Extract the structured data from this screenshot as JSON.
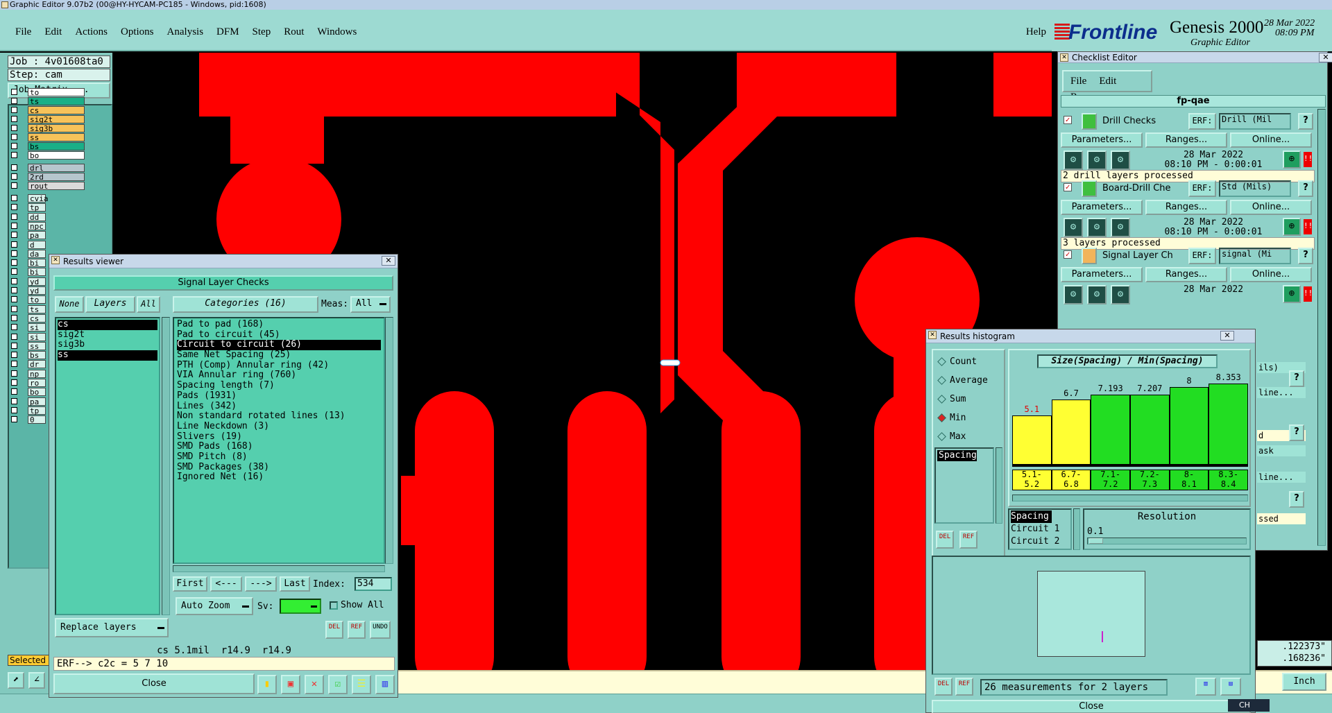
{
  "window": {
    "title": "Graphic Editor 9.07b2 (00@HY-HYCAM-PC185 - Windows, pid:1608)"
  },
  "menubar": {
    "items": [
      "File",
      "Edit",
      "Actions",
      "Options",
      "Analysis",
      "DFM",
      "Step",
      "Rout",
      "Windows"
    ],
    "help": "Help"
  },
  "brand": {
    "logo": "Frontline",
    "product": "Genesis 2000",
    "subtitle": "Graphic Editor",
    "date": "28 Mar 2022",
    "time": "08:09 PM"
  },
  "job": {
    "job_label": "Job : 4v01608ta0",
    "step_label": "Step: cam",
    "matrix_button": "Job Matrix ..."
  },
  "layers_top": [
    {
      "name": "to",
      "color": "#ffffff"
    },
    {
      "name": "ts",
      "color": "#1aaf87"
    },
    {
      "name": "cs",
      "color": "#f6c35a"
    },
    {
      "name": "sig2t",
      "color": "#f6c35a"
    },
    {
      "name": "sig3b",
      "color": "#f6c35a"
    },
    {
      "name": "ss",
      "color": "#f6c35a"
    },
    {
      "name": "bs",
      "color": "#1aaf87"
    },
    {
      "name": "bo",
      "color": "#ffffff"
    }
  ],
  "layers_drill": [
    {
      "name": "drl",
      "color": "#b6c6cd"
    },
    {
      "name": "2rd",
      "color": "#b6c6cd"
    },
    {
      "name": "rout",
      "color": "#dadada"
    }
  ],
  "layers_more": [
    "cvia",
    "tp",
    "dd",
    "npc",
    "pa",
    "d",
    "da",
    "bi",
    "bi",
    "yd",
    "yd",
    "to",
    "ts",
    "cs",
    "si",
    "si",
    "ss",
    "bs",
    "dr",
    "np",
    "ro",
    "bo",
    "pa",
    "tp",
    "0"
  ],
  "status_left": {
    "selected": "Selected"
  },
  "results_viewer": {
    "title": "Results viewer",
    "header": "Signal Layer Checks",
    "none_btn": "None",
    "layers_btn": "Layers",
    "all_btn": "All",
    "layer_list": [
      "cs",
      "sig2t",
      "sig3b",
      "ss"
    ],
    "categories_label": "Categories (16)",
    "meas_label": "Meas:",
    "meas_value": "All",
    "categories": [
      "Pad to pad (168)",
      "Pad to circuit (45)",
      "Circuit to circuit (26)",
      "Same Net Spacing (25)",
      "PTH (Comp) Annular ring (42)",
      "VIA Annular ring (760)",
      "Spacing length (7)",
      "Pads (1931)",
      "Lines (342)",
      "Non standard rotated lines (13)",
      "Line Neckdown (3)",
      "Slivers (19)",
      "SMD Pads (168)",
      "SMD Pitch (8)",
      "SMD Packages (38)",
      "Ignored Net (16)"
    ],
    "nav": {
      "first": "First",
      "prev": "<---",
      "next": "--->",
      "last": "Last",
      "index_label": "Index:",
      "index_value": "534"
    },
    "auto_zoom": "Auto Zoom",
    "sv_label": "Sv:",
    "show_all": "Show All",
    "replace_layers": "Replace layers",
    "icon_del": "DEL",
    "icon_ref": "REF",
    "icon_undo": "UNDO",
    "measure_line": "cs 5.1mil  r14.9  r14.9",
    "erf_line": "ERF--> c2c = 5 7 10",
    "close": "Close"
  },
  "checklist": {
    "title": "Checklist Editor",
    "menu": [
      "File",
      "Edit",
      "Run"
    ],
    "name": "fp-qae",
    "checks": [
      {
        "name": "Drill Checks",
        "erf": "ERF:",
        "erf_value": "Drill (Mil",
        "date": "28 Mar 2022",
        "time": "08:10 PM - 0:00:01",
        "status": "2 drill layers processed"
      },
      {
        "name": "Board-Drill Che",
        "erf": "ERF:",
        "erf_value": "Std (Mils)",
        "date": "28 Mar 2022",
        "time": "08:10 PM - 0:00:01",
        "status": "3 layers processed"
      },
      {
        "name": "Signal Layer Ch",
        "erf": "ERF:",
        "erf_value": "signal (Mi",
        "date": "28 Mar 2022",
        "time": "",
        "status": ""
      }
    ],
    "parameters": "Parameters...",
    "ranges": "Ranges...",
    "online": "Online...",
    "partial": [
      "ils)",
      "line...",
      "d",
      "ask",
      "line...",
      "ssed"
    ],
    "help": "?"
  },
  "histogram": {
    "title": "Results histogram",
    "options": [
      "Count",
      "Average",
      "Sum",
      "Min",
      "Max"
    ],
    "selected_option": "Min",
    "measure_list": [
      "Spacing"
    ],
    "chart_title": "Size(Spacing) / Min(Spacing)",
    "legend_rows": [
      "Spacing",
      "Circuit 1",
      "Circuit 2"
    ],
    "resolution_label": "Resolution",
    "resolution_value": "0.1",
    "summary": "26 measurements for 2 layers",
    "close": "Close",
    "del": "DEL",
    "ref": "REF"
  },
  "chart_data": {
    "type": "bar",
    "title": "Size(Spacing) / Min(Spacing)",
    "categories": [
      "5.1-5.2",
      "6.7-6.8",
      "7.1-7.2",
      "7.2-7.3",
      "8-8.1",
      "8.3-8.4"
    ],
    "category_lines": [
      [
        "5.1-",
        "5.2"
      ],
      [
        "6.7-",
        "6.8"
      ],
      [
        "7.1-",
        "7.2"
      ],
      [
        "7.2-",
        "7.3"
      ],
      [
        "8-",
        "8.1"
      ],
      [
        "8.3-",
        "8.4"
      ]
    ],
    "values": [
      5.1,
      6.7,
      7.193,
      7.207,
      8,
      8.353
    ],
    "value_labels": [
      "5.1",
      "6.7",
      "7.193",
      "7.207",
      "8",
      "8.353"
    ],
    "colors": [
      "#ffff33",
      "#ffff33",
      "#22dd22",
      "#22dd22",
      "#22dd22",
      "#22dd22"
    ],
    "highlight_color": "#e00000",
    "ylim": [
      0,
      9
    ]
  },
  "coords": {
    "x": ".122373\"",
    "y": ".168236\""
  },
  "units": "Inch",
  "taskbar": {
    "lang": "CH"
  }
}
